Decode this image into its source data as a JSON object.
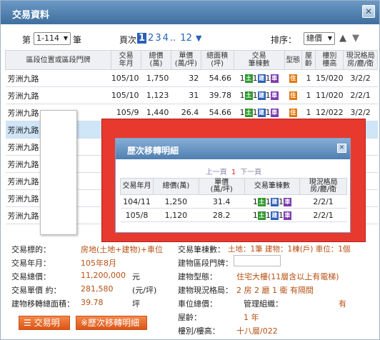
{
  "window": {
    "title": "交易資料"
  },
  "pager": {
    "prefix": "第",
    "range": "1-114",
    "suffix": "筆",
    "page_label": "頁次",
    "pages": [
      "1",
      "2",
      "3",
      "4",
      "..",
      "12"
    ],
    "sort_label": "排序：",
    "sort_value": "總價"
  },
  "table": {
    "headers": [
      "區段位置或區段門牌",
      "交易\n年月",
      "總價\n(萬)",
      "單價\n(萬/坪)",
      "總面積\n(坪)",
      "交易\n筆棟數",
      "型態",
      "屋\n齡",
      "樓別\n樓高",
      "現況格局\n房/廳/衛"
    ],
    "rows": [
      {
        "addr": "芳洲九路",
        "date": "105/10",
        "total": "1,750",
        "unit": "32",
        "area": "54.66",
        "land": "1",
        "bldg": "1",
        "park": "1",
        "type": "住",
        "age": "1",
        "floor": "15/020",
        "layout": "3/2/2"
      },
      {
        "addr": "芳洲九路",
        "date": "105/10",
        "total": "1,123",
        "unit": "31",
        "area": "39.78",
        "land": "1",
        "bldg": "1",
        "park": "1",
        "type": "住",
        "age": "1",
        "floor": "11/020",
        "layout": "2/2/1"
      },
      {
        "addr": "芳洲九路",
        "date": "105/9",
        "total": "1,440",
        "unit": "26.4",
        "area": "54.66",
        "land": "1",
        "bldg": "1",
        "park": "1",
        "type": "住",
        "age": "1",
        "floor": "12/022",
        "layout": "3/2/2"
      },
      {
        "addr": "芳洲九路"
      },
      {
        "addr": "芳洲九路"
      },
      {
        "addr": "芳洲九路"
      },
      {
        "addr": "芳洲九路"
      },
      {
        "addr": "芳洲九路"
      },
      {
        "addr": "芳洲九路"
      }
    ]
  },
  "badges": {
    "land": "土",
    "bldg": "建",
    "park": "車"
  },
  "detail": {
    "target_label": "交易標的：",
    "target_value": "房地(土地+建物)+車位",
    "date_label": "交易年月：",
    "date_value": "105年8月",
    "total_label": "交易總價：",
    "total_value": "11,200,000",
    "total_unit": "元",
    "unit_label": "交易單價 約：",
    "unit_value": "281,580",
    "unit_unit": "(元/坪)",
    "area_label": "建物移轉總面積：",
    "area_value": "39.78",
    "area_unit": "坪",
    "count_label": "交易筆棟數：",
    "count_value": "土地：1筆 建物：1棟(戶) 車位：1個",
    "door_label": "建物區段門牌：",
    "bldg_type_label": "建物型態：",
    "bldg_type_value": "住宅大樓(11層含以上有電梯)",
    "layout_label": "建物現況格局：",
    "layout_value": "2 房 2 廳 1 衛 有隔間",
    "park_total_label": "車位總價：",
    "mgmt_label": "管理組織：",
    "mgmt_value": "有",
    "age_label": "屋齡：",
    "age_value": "1 年",
    "floor_label": "樓別/樓高：",
    "floor_value": "十八層/022"
  },
  "buttons": {
    "detail": "交易明細",
    "history": "※歷次移轉明細"
  },
  "modal": {
    "title": "歷次移轉明細",
    "prev": "上一頁",
    "current": "1",
    "next": "下一頁",
    "headers": [
      "交易年月",
      "總價(萬)",
      "單價\n(萬/坪)",
      "交易筆棟數",
      "現況格局\n房/廳/衛"
    ],
    "rows": [
      {
        "date": "104/11",
        "total": "1,250",
        "unit": "31.4",
        "land": "1",
        "bldg": "1",
        "park": "1",
        "layout": "2/2/1"
      },
      {
        "date": "105/8",
        "total": "1,120",
        "unit": "28.2",
        "land": "1",
        "bldg": "1",
        "park": "1",
        "layout": "2/2/1"
      }
    ]
  },
  "colors": {
    "accent": "#2a60b5",
    "highlight_box": "#e8392f",
    "value_text": "#b65012"
  }
}
